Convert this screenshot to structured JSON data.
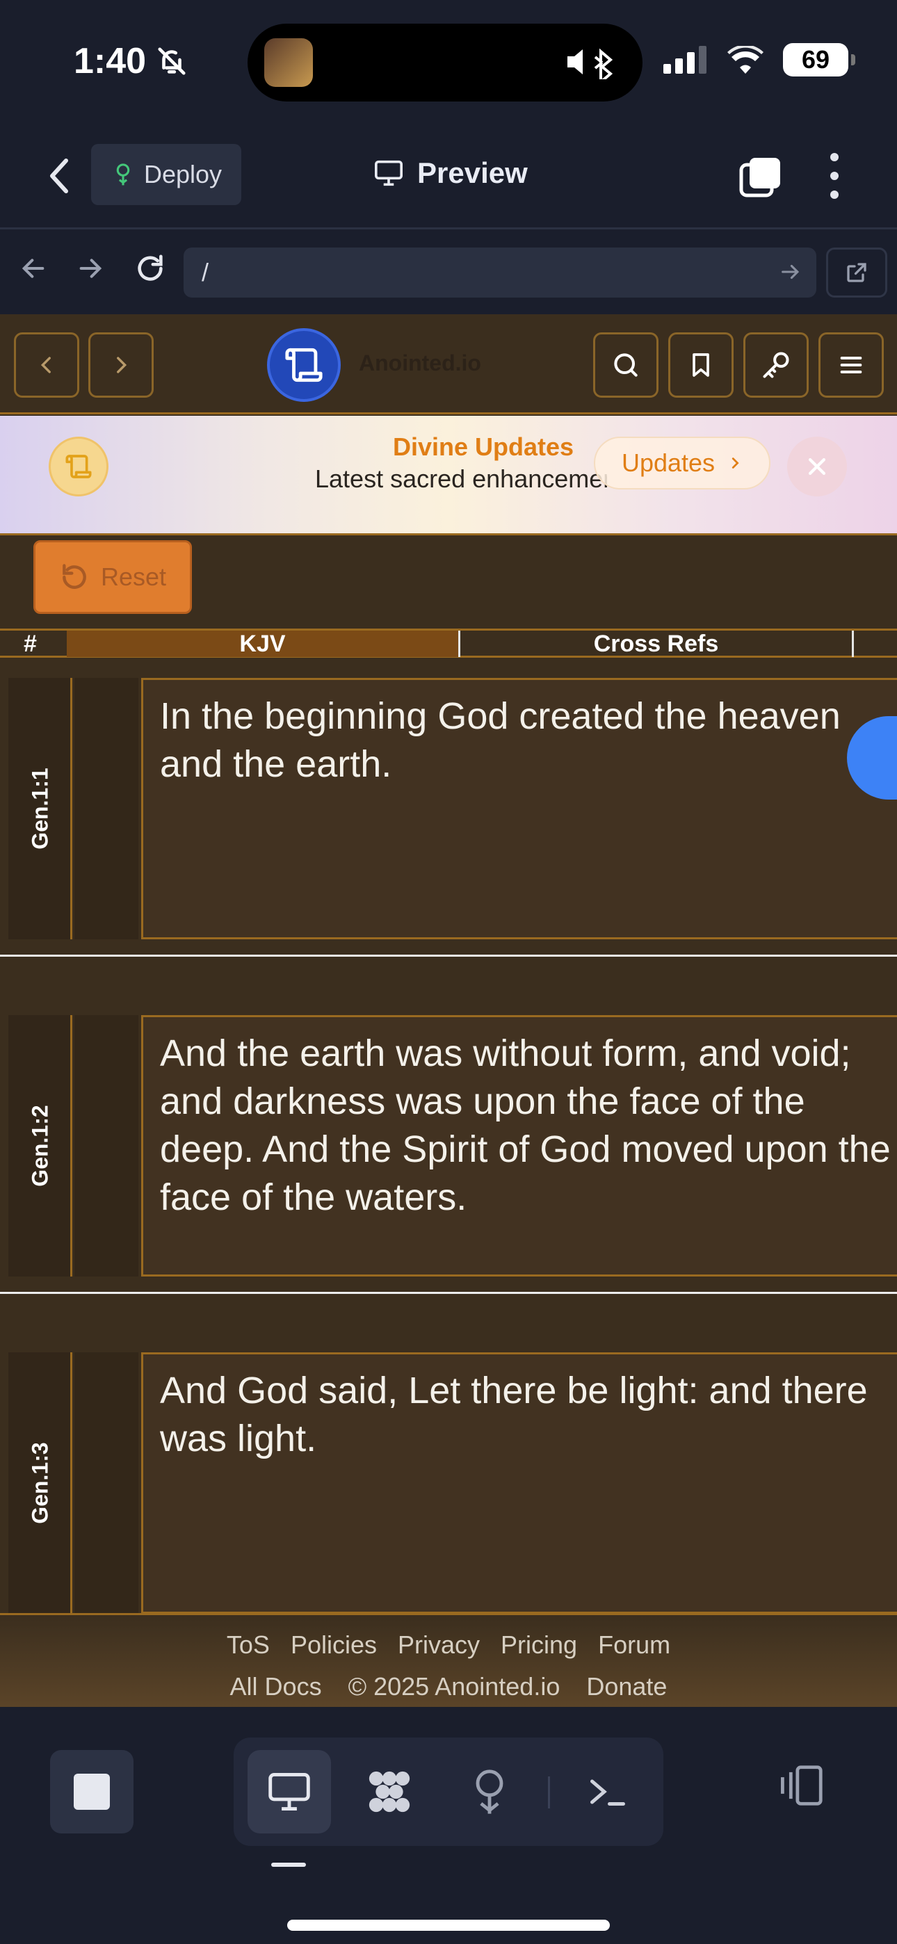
{
  "status_bar": {
    "time": "1:40",
    "battery": "69"
  },
  "header": {
    "deploy_label": "Deploy",
    "preview_label": "Preview"
  },
  "browser": {
    "url": "/"
  },
  "app": {
    "brand": "Anointed.io",
    "banner": {
      "title": "Divine Updates",
      "subtitle": "Latest sacred enhancements",
      "button_label": "Updates"
    },
    "reset_label": "Reset",
    "table": {
      "headers": {
        "num": "#",
        "kjv": "KJV",
        "cross_refs": "Cross Refs"
      },
      "rows": [
        {
          "ref": "Gen.1:1",
          "text": "In the beginning God created the heaven and the earth."
        },
        {
          "ref": "Gen.1:2",
          "text": "And the earth was without form, and void; and darkness was upon the face of the deep. And the Spirit of God moved upon the face of the waters."
        },
        {
          "ref": "Gen.1:3",
          "text": "And God said, Let there be light: and there was light."
        }
      ]
    },
    "footer": {
      "row1": [
        "ToS",
        "Policies",
        "Privacy",
        "Pricing",
        "Forum"
      ],
      "row2": [
        "All Docs",
        "© 2025 Anointed.io",
        "Donate"
      ]
    }
  },
  "colors": {
    "accent_orange": "#e07e15",
    "app_bg": "#3b2e1e",
    "gold_border": "#9a6a20",
    "logo_blue": "#2248b8"
  }
}
